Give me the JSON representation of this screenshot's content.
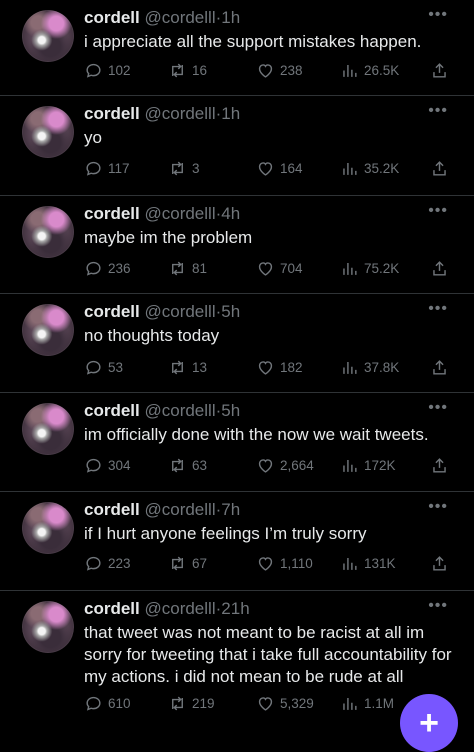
{
  "tweets": [
    {
      "name": "cordell",
      "handle": "@cordelll",
      "time": "1h",
      "text": "i appreciate all the support mistakes happen.",
      "replies": "102",
      "retweets": "16",
      "likes": "238",
      "views": "26.5K"
    },
    {
      "name": "cordell",
      "handle": "@cordelll",
      "time": "1h",
      "text": "yo",
      "replies": "117",
      "retweets": "3",
      "likes": "164",
      "views": "35.2K"
    },
    {
      "name": "cordell",
      "handle": "@cordelll",
      "time": "4h",
      "text": "maybe im the problem",
      "replies": "236",
      "retweets": "81",
      "likes": "704",
      "views": "75.2K"
    },
    {
      "name": "cordell",
      "handle": "@cordelll",
      "time": "5h",
      "text": "no thoughts today",
      "replies": "53",
      "retweets": "13",
      "likes": "182",
      "views": "37.8K"
    },
    {
      "name": "cordell",
      "handle": "@cordelll",
      "time": "5h",
      "text": "im officially done with the now we wait tweets.",
      "replies": "304",
      "retweets": "63",
      "likes": "2,664",
      "views": "172K"
    },
    {
      "name": "cordell",
      "handle": "@cordelll",
      "time": "7h",
      "text": "if I hurt anyone feelings I’m truly sorry",
      "replies": "223",
      "retweets": "67",
      "likes": "1,110",
      "views": "131K"
    },
    {
      "name": "cordell",
      "handle": "@cordelll",
      "time": "21h",
      "text": "that tweet was not meant to be racist at all im sorry for tweeting that i take full accountability for my actions. i did not mean to be rude at all",
      "replies": "610",
      "retweets": "219",
      "likes": "5,329",
      "views": "1.1M"
    }
  ],
  "separator": "·",
  "more_icon": "more-dots-icon",
  "compose_button": {
    "label": "+",
    "icon": "compose-plus-icon",
    "color": "#7856ff"
  },
  "colors": {
    "background": "#000000",
    "text": "#e7e9ea",
    "muted": "#71767b",
    "divider": "#2f3336"
  }
}
